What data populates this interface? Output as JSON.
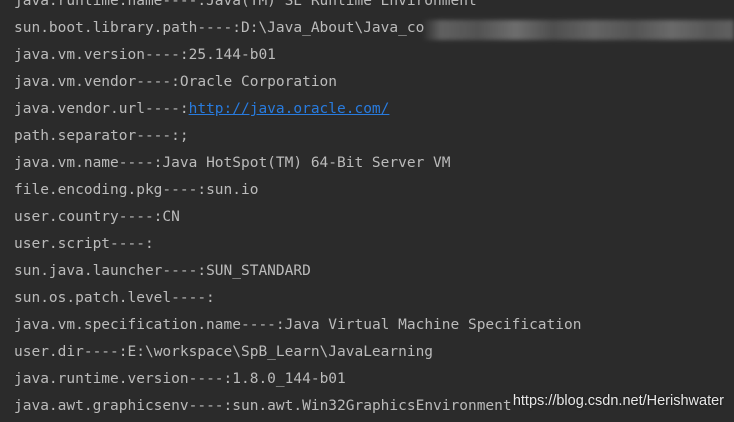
{
  "console": {
    "lines": [
      {
        "key": "java.runtime.name",
        "sep": "----:",
        "value": "Java(TM) SE Runtime Environment"
      },
      {
        "key": "sun.boot.library.path",
        "sep": "----:",
        "value": "D:\\Java_About\\Java_co"
      },
      {
        "key": "java.vm.version",
        "sep": "----:",
        "value": "25.144-b01"
      },
      {
        "key": "java.vm.vendor",
        "sep": "----:",
        "value": "Oracle Corporation"
      },
      {
        "key": "java.vendor.url",
        "sep": "----:",
        "value": "http://java.oracle.com/"
      },
      {
        "key": "path.separator",
        "sep": "----:",
        "value": ";"
      },
      {
        "key": "java.vm.name",
        "sep": "----:",
        "value": "Java HotSpot(TM) 64-Bit Server VM"
      },
      {
        "key": "file.encoding.pkg",
        "sep": "----:",
        "value": "sun.io"
      },
      {
        "key": "user.country",
        "sep": "----:",
        "value": "CN"
      },
      {
        "key": "user.script",
        "sep": "----:",
        "value": ""
      },
      {
        "key": "sun.java.launcher",
        "sep": "----:",
        "value": "SUN_STANDARD"
      },
      {
        "key": "sun.os.patch.level",
        "sep": "----:",
        "value": ""
      },
      {
        "key": "java.vm.specification.name",
        "sep": "----:",
        "value": "Java Virtual Machine Specification"
      },
      {
        "key": "user.dir",
        "sep": "----:",
        "value": "E:\\workspace\\SpB_Learn\\JavaLearning"
      },
      {
        "key": "java.runtime.version",
        "sep": "----:",
        "value": "1.8.0_144-b01"
      },
      {
        "key": "java.awt.graphicsenv",
        "sep": "----:",
        "value": "sun.awt.Win32GraphicsEnvironment"
      }
    ]
  },
  "watermark": {
    "text": "https://blog.csdn.net/Herishwater"
  },
  "colors": {
    "background": "#2b2b2b",
    "text": "#bbbbbb",
    "link": "#287bde"
  }
}
